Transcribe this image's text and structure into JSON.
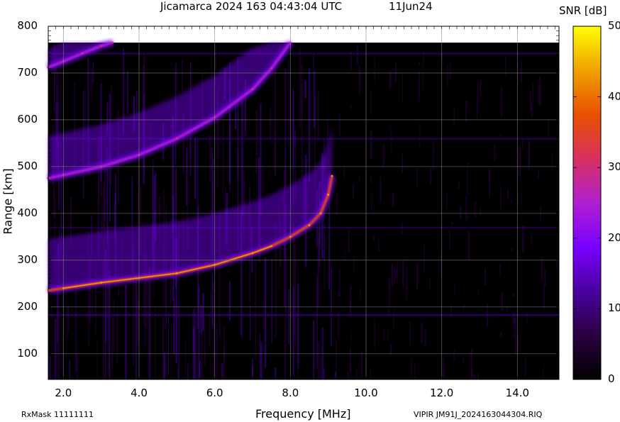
{
  "chart_data": {
    "type": "heatmap",
    "title": "Jicamarca 2024 163 04:43:04 UTC",
    "date": "11Jun24",
    "xlabel": "Frequency [MHz]",
    "ylabel": "Range [km]",
    "xlim": [
      1.6,
      15.1
    ],
    "ylim": [
      45,
      800
    ],
    "data_top_km": 765,
    "xticks": [
      "2.0",
      "4.0",
      "6.0",
      "8.0",
      "10.0",
      "12.0",
      "14.0"
    ],
    "xtick_values": [
      2,
      4,
      6,
      8,
      10,
      12,
      14
    ],
    "yticks": [
      "100",
      "200",
      "300",
      "400",
      "500",
      "600",
      "700",
      "800"
    ],
    "ytick_values": [
      100,
      200,
      300,
      400,
      500,
      600,
      700,
      800
    ],
    "grid": true,
    "colorbar": {
      "label": "SNR [dB]",
      "range": [
        0,
        50
      ],
      "ticks": [
        "0",
        "10",
        "20",
        "30",
        "40",
        "50"
      ],
      "tick_values": [
        0,
        10,
        20,
        30,
        40,
        50
      ],
      "colors": [
        "#000000",
        "#2a0040",
        "#4a00a0",
        "#7a00ff",
        "#b020d0",
        "#d83060",
        "#e85000",
        "#f0a000",
        "#ffff00"
      ]
    },
    "traces": [
      {
        "name": "",
        "freq_mhz": [
          1.6,
          2.0,
          3.0,
          4.0,
          5.0,
          6.0,
          7.0,
          7.5,
          8.0,
          8.5,
          8.8,
          9.0,
          9.1
        ],
        "range_km": [
          235,
          240,
          252,
          262,
          272,
          290,
          315,
          330,
          350,
          375,
          400,
          440,
          480
        ]
      },
      {
        "name": "",
        "freq_mhz": [
          1.6,
          2.0,
          3.0,
          4.0,
          5.0,
          6.0,
          7.0,
          7.5,
          8.0
        ],
        "range_km": [
          475,
          482,
          500,
          525,
          560,
          605,
          665,
          710,
          765
        ]
      },
      {
        "name": "",
        "freq_mhz": [
          1.6,
          2.0,
          2.5,
          3.0,
          3.3
        ],
        "range_km": [
          712,
          725,
          742,
          758,
          765
        ]
      }
    ]
  },
  "footer": {
    "rxmask": "RxMask 11111111",
    "file": "VIPIR  JM91J_2024163044304.RIQ"
  }
}
